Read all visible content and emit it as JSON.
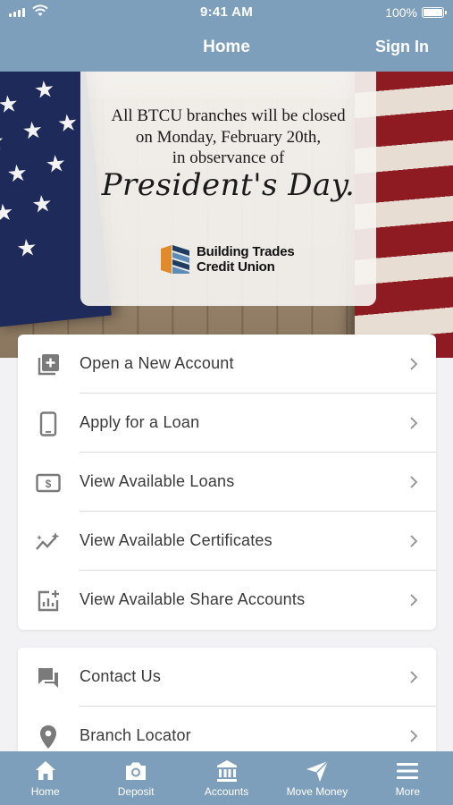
{
  "status_bar": {
    "time": "9:41 AM",
    "battery": "100%"
  },
  "header": {
    "title": "Home",
    "sign_in": "Sign In"
  },
  "banner": {
    "line1": "All BTCU branches will be closed",
    "line2": "on Monday, February 20th,",
    "line3": "in observance of",
    "holiday": "President's Day.",
    "logo_line1": "Building Trades",
    "logo_line2": "Credit Union"
  },
  "menu_primary": [
    {
      "label": "Open a New Account",
      "icon": "add-box-icon"
    },
    {
      "label": "Apply for a Loan",
      "icon": "phone-icon"
    },
    {
      "label": "View Available Loans",
      "icon": "money-icon"
    },
    {
      "label": "View Available Certificates",
      "icon": "trending-sparkle-icon"
    },
    {
      "label": "View Available Share Accounts",
      "icon": "chart-plus-icon"
    }
  ],
  "menu_secondary": [
    {
      "label": "Contact Us",
      "icon": "chat-icon"
    },
    {
      "label": "Branch Locator",
      "icon": "location-pin-icon"
    }
  ],
  "tabbar": [
    {
      "label": "Home",
      "icon": "home-icon"
    },
    {
      "label": "Deposit",
      "icon": "camera-icon"
    },
    {
      "label": "Accounts",
      "icon": "bank-icon"
    },
    {
      "label": "Move Money",
      "icon": "send-icon"
    },
    {
      "label": "More",
      "icon": "menu-icon"
    }
  ],
  "colors": {
    "brand_bar": "#7d9fbc",
    "background": "#f2f2f4",
    "text": "#3a3a3a",
    "icon_gray": "#7a7a7a"
  }
}
